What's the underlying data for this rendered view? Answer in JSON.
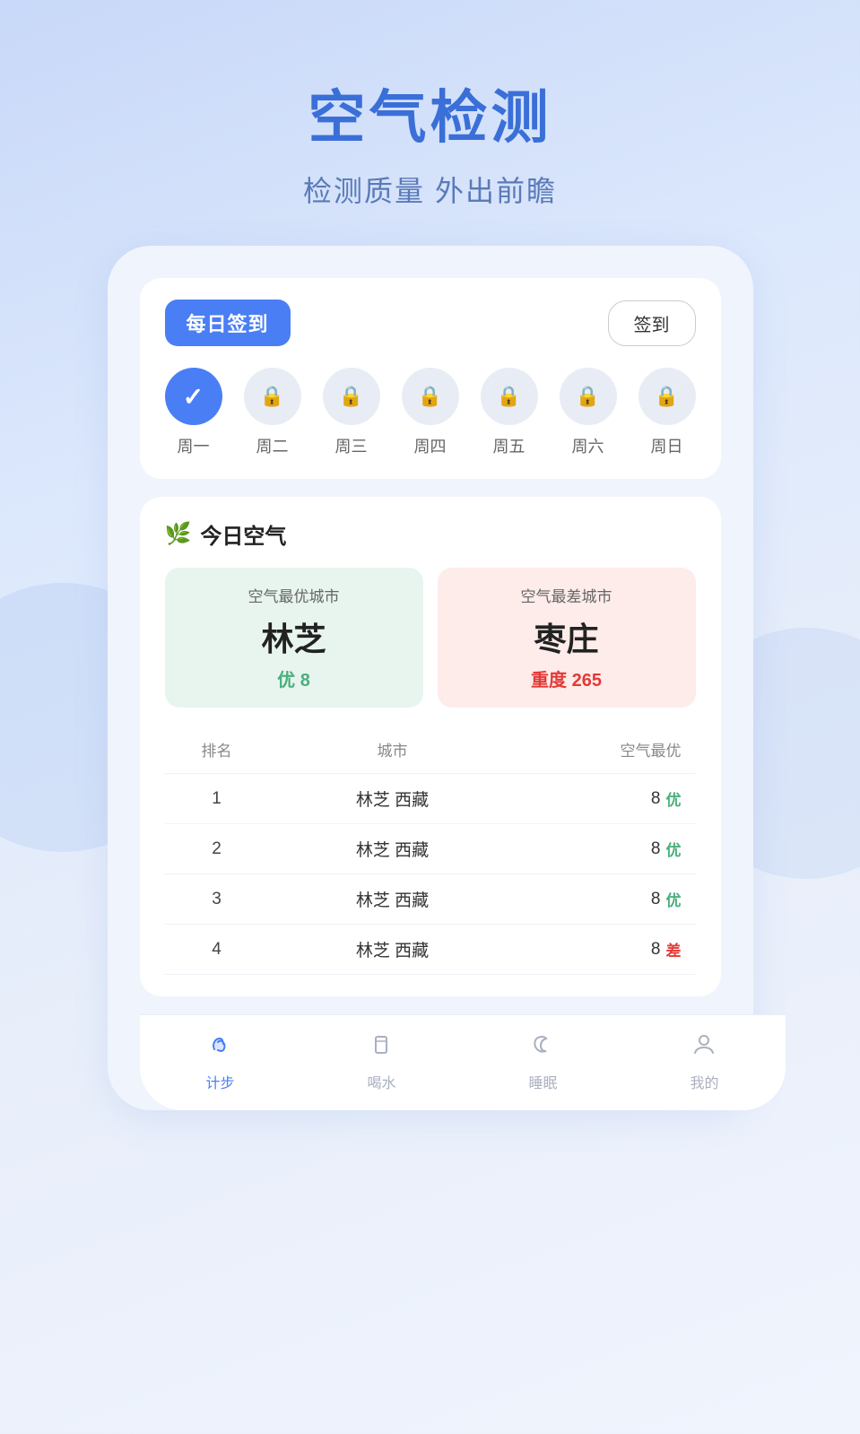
{
  "header": {
    "title": "空气检测",
    "subtitle": "检测质量 外出前瞻"
  },
  "checkin": {
    "title": "每日签到",
    "button_label": "签到",
    "days": [
      {
        "label": "周一",
        "active": true
      },
      {
        "label": "周二",
        "active": false
      },
      {
        "label": "周三",
        "active": false
      },
      {
        "label": "周四",
        "active": false
      },
      {
        "label": "周五",
        "active": false
      },
      {
        "label": "周六",
        "active": false
      },
      {
        "label": "周日",
        "active": false
      }
    ]
  },
  "air_section": {
    "title": "今日空气",
    "best_city_label": "空气最优城市",
    "best_city_name": "林芝",
    "best_city_value": "优 8",
    "worst_city_label": "空气最差城市",
    "worst_city_name": "枣庄",
    "worst_city_value": "重度 265"
  },
  "ranking": {
    "col_rank": "排名",
    "col_city": "城市",
    "col_quality": "空气最优",
    "rows": [
      {
        "rank": "1",
        "city": "林芝 西藏",
        "value": "8",
        "badge": "优",
        "badge_type": "green"
      },
      {
        "rank": "2",
        "city": "林芝 西藏",
        "value": "8",
        "badge": "优",
        "badge_type": "green"
      },
      {
        "rank": "3",
        "city": "林芝 西藏",
        "value": "8",
        "badge": "优",
        "badge_type": "green"
      },
      {
        "rank": "4",
        "city": "林芝 西藏",
        "value": "8",
        "badge": "差",
        "badge_type": "red"
      }
    ]
  },
  "nav": {
    "items": [
      {
        "label": "计步",
        "icon": "👟",
        "active": true
      },
      {
        "label": "喝水",
        "icon": "🥛",
        "active": false
      },
      {
        "label": "睡眠",
        "icon": "😴",
        "active": false
      },
      {
        "label": "我的",
        "icon": "👤",
        "active": false
      }
    ]
  }
}
